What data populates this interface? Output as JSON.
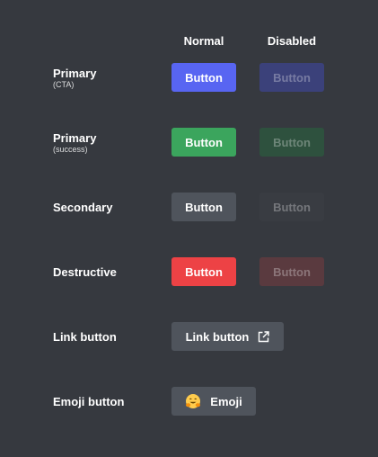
{
  "headers": {
    "normal": "Normal",
    "disabled": "Disabled"
  },
  "colors": {
    "background": "#36393f",
    "primary": "#5865f2",
    "primary_disabled": "#3b417a",
    "success": "#3ba55d",
    "success_disabled": "#2e513e",
    "secondary": "#4f545c",
    "secondary_disabled": "#393c42",
    "destructive": "#ed4245",
    "destructive_disabled": "#5a3a3f",
    "link": "#4f545c"
  },
  "rows": {
    "primary_cta": {
      "label": "Primary",
      "sub": "(CTA)",
      "normal": "Button",
      "disabled": "Button"
    },
    "primary_success": {
      "label": "Primary",
      "sub": "(success)",
      "normal": "Button",
      "disabled": "Button"
    },
    "secondary": {
      "label": "Secondary",
      "normal": "Button",
      "disabled": "Button"
    },
    "destructive": {
      "label": "Destructive",
      "normal": "Button",
      "disabled": "Button"
    },
    "link": {
      "label": "Link button",
      "button": "Link button",
      "icon": "external-link-icon"
    },
    "emoji": {
      "label": "Emoji button",
      "button": "Emoji",
      "icon": "hugging-face-emoji-icon"
    }
  }
}
